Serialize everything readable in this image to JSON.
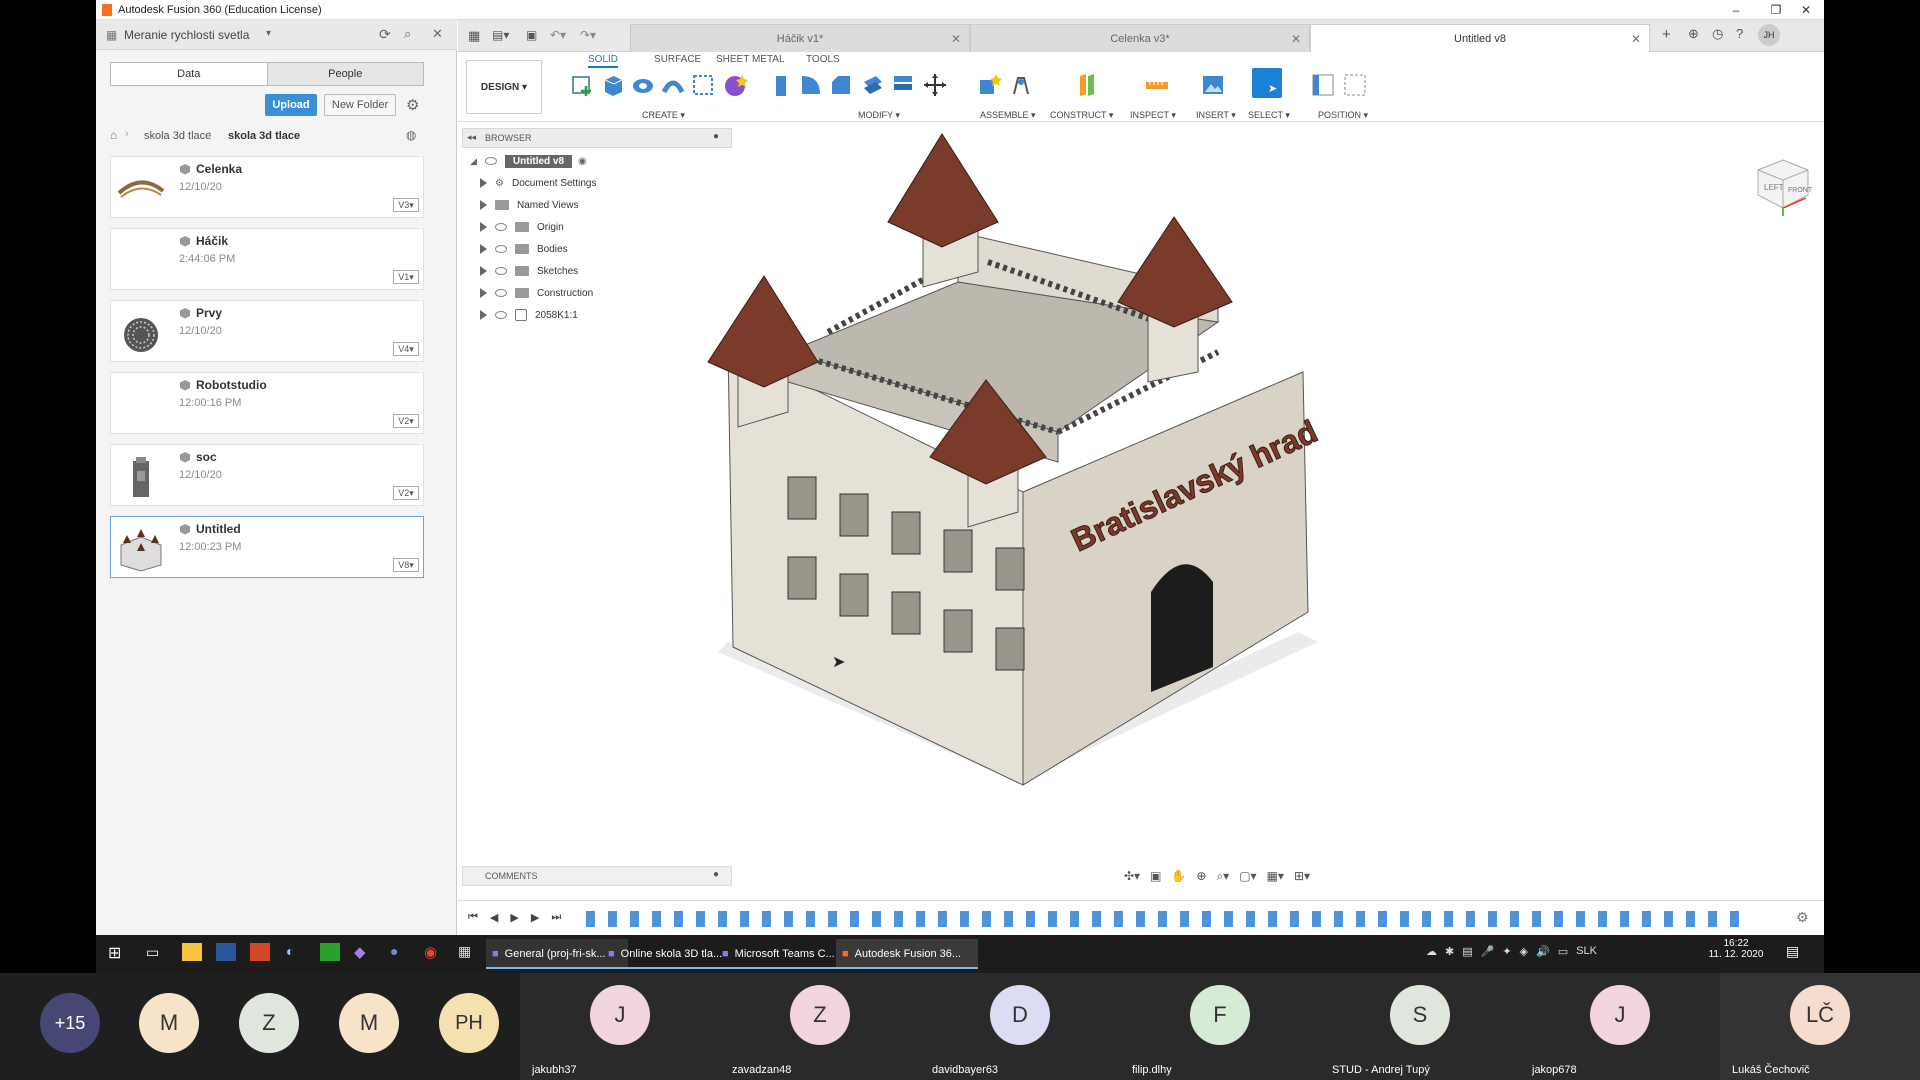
{
  "window": {
    "title": "Autodesk Fusion 360 (Education License)"
  },
  "left_panel": {
    "project": "Meranie rychlosti svetla",
    "tabs": [
      "Data",
      "People"
    ],
    "upload_label": "Upload",
    "new_folder_label": "New Folder",
    "breadcrumb": [
      "skola 3d tlace",
      "skola 3d tlace"
    ],
    "files": [
      {
        "name": "Celenka",
        "date": "12/10/20",
        "version": "V3"
      },
      {
        "name": "Háčik",
        "date": "2:44:06 PM",
        "version": "V1"
      },
      {
        "name": "Prvy",
        "date": "12/10/20",
        "version": "V4"
      },
      {
        "name": "Robotstudio",
        "date": "12:00:16 PM",
        "version": "V2"
      },
      {
        "name": "soc",
        "date": "12/10/20",
        "version": "V2"
      },
      {
        "name": "Untitled",
        "date": "12:00:23 PM",
        "version": "V8"
      }
    ]
  },
  "doc_tabs": [
    {
      "label": "Háčik v1*"
    },
    {
      "label": "Celenka v3*"
    },
    {
      "label": "Untitled v8"
    }
  ],
  "toolbar": {
    "workspace": "DESIGN",
    "tabs": [
      "SOLID",
      "SURFACE",
      "SHEET METAL",
      "TOOLS"
    ],
    "groups": [
      "CREATE",
      "MODIFY",
      "ASSEMBLE",
      "CONSTRUCT",
      "INSPECT",
      "INSERT",
      "SELECT",
      "POSITION"
    ]
  },
  "browser": {
    "title": "BROWSER",
    "root": "Untitled v8",
    "items": [
      "Document Settings",
      "Named Views",
      "Origin",
      "Bodies",
      "Sketches",
      "Construction",
      "2058K1:1"
    ]
  },
  "comments": {
    "title": "COMMENTS"
  },
  "model": {
    "sign_text": "Bratislavský hrad"
  },
  "viewcube": {
    "left": "LEFT",
    "front": "FRONT"
  },
  "taskbar": {
    "apps": [
      "General (proj-fri-sk...",
      "Online skola 3D tla...",
      "Microsoft Teams C...",
      "Autodesk Fusion 36..."
    ],
    "lang": "SLK",
    "time": "16:22",
    "date": "11. 12. 2020"
  },
  "meeting": {
    "more": "+15",
    "avatars": [
      "M",
      "Z",
      "M",
      "PH"
    ],
    "participants": [
      {
        "initial": "J",
        "name": "jakubh37"
      },
      {
        "initial": "Z",
        "name": "zavadzan48"
      },
      {
        "initial": "D",
        "name": "davidbayer63"
      },
      {
        "initial": "F",
        "name": "filip.dlhy"
      },
      {
        "initial": "S",
        "name": "STUD - Andrej Tupý"
      },
      {
        "initial": "J",
        "name": "jakop678"
      },
      {
        "initial": "LČ",
        "name": "Lukáš Čechovič"
      }
    ]
  },
  "colors": {
    "accent": "#1a73c8",
    "roof": "#7a3b2b",
    "wall": "#e8e3da",
    "taskbar": "#1c1c1c"
  }
}
